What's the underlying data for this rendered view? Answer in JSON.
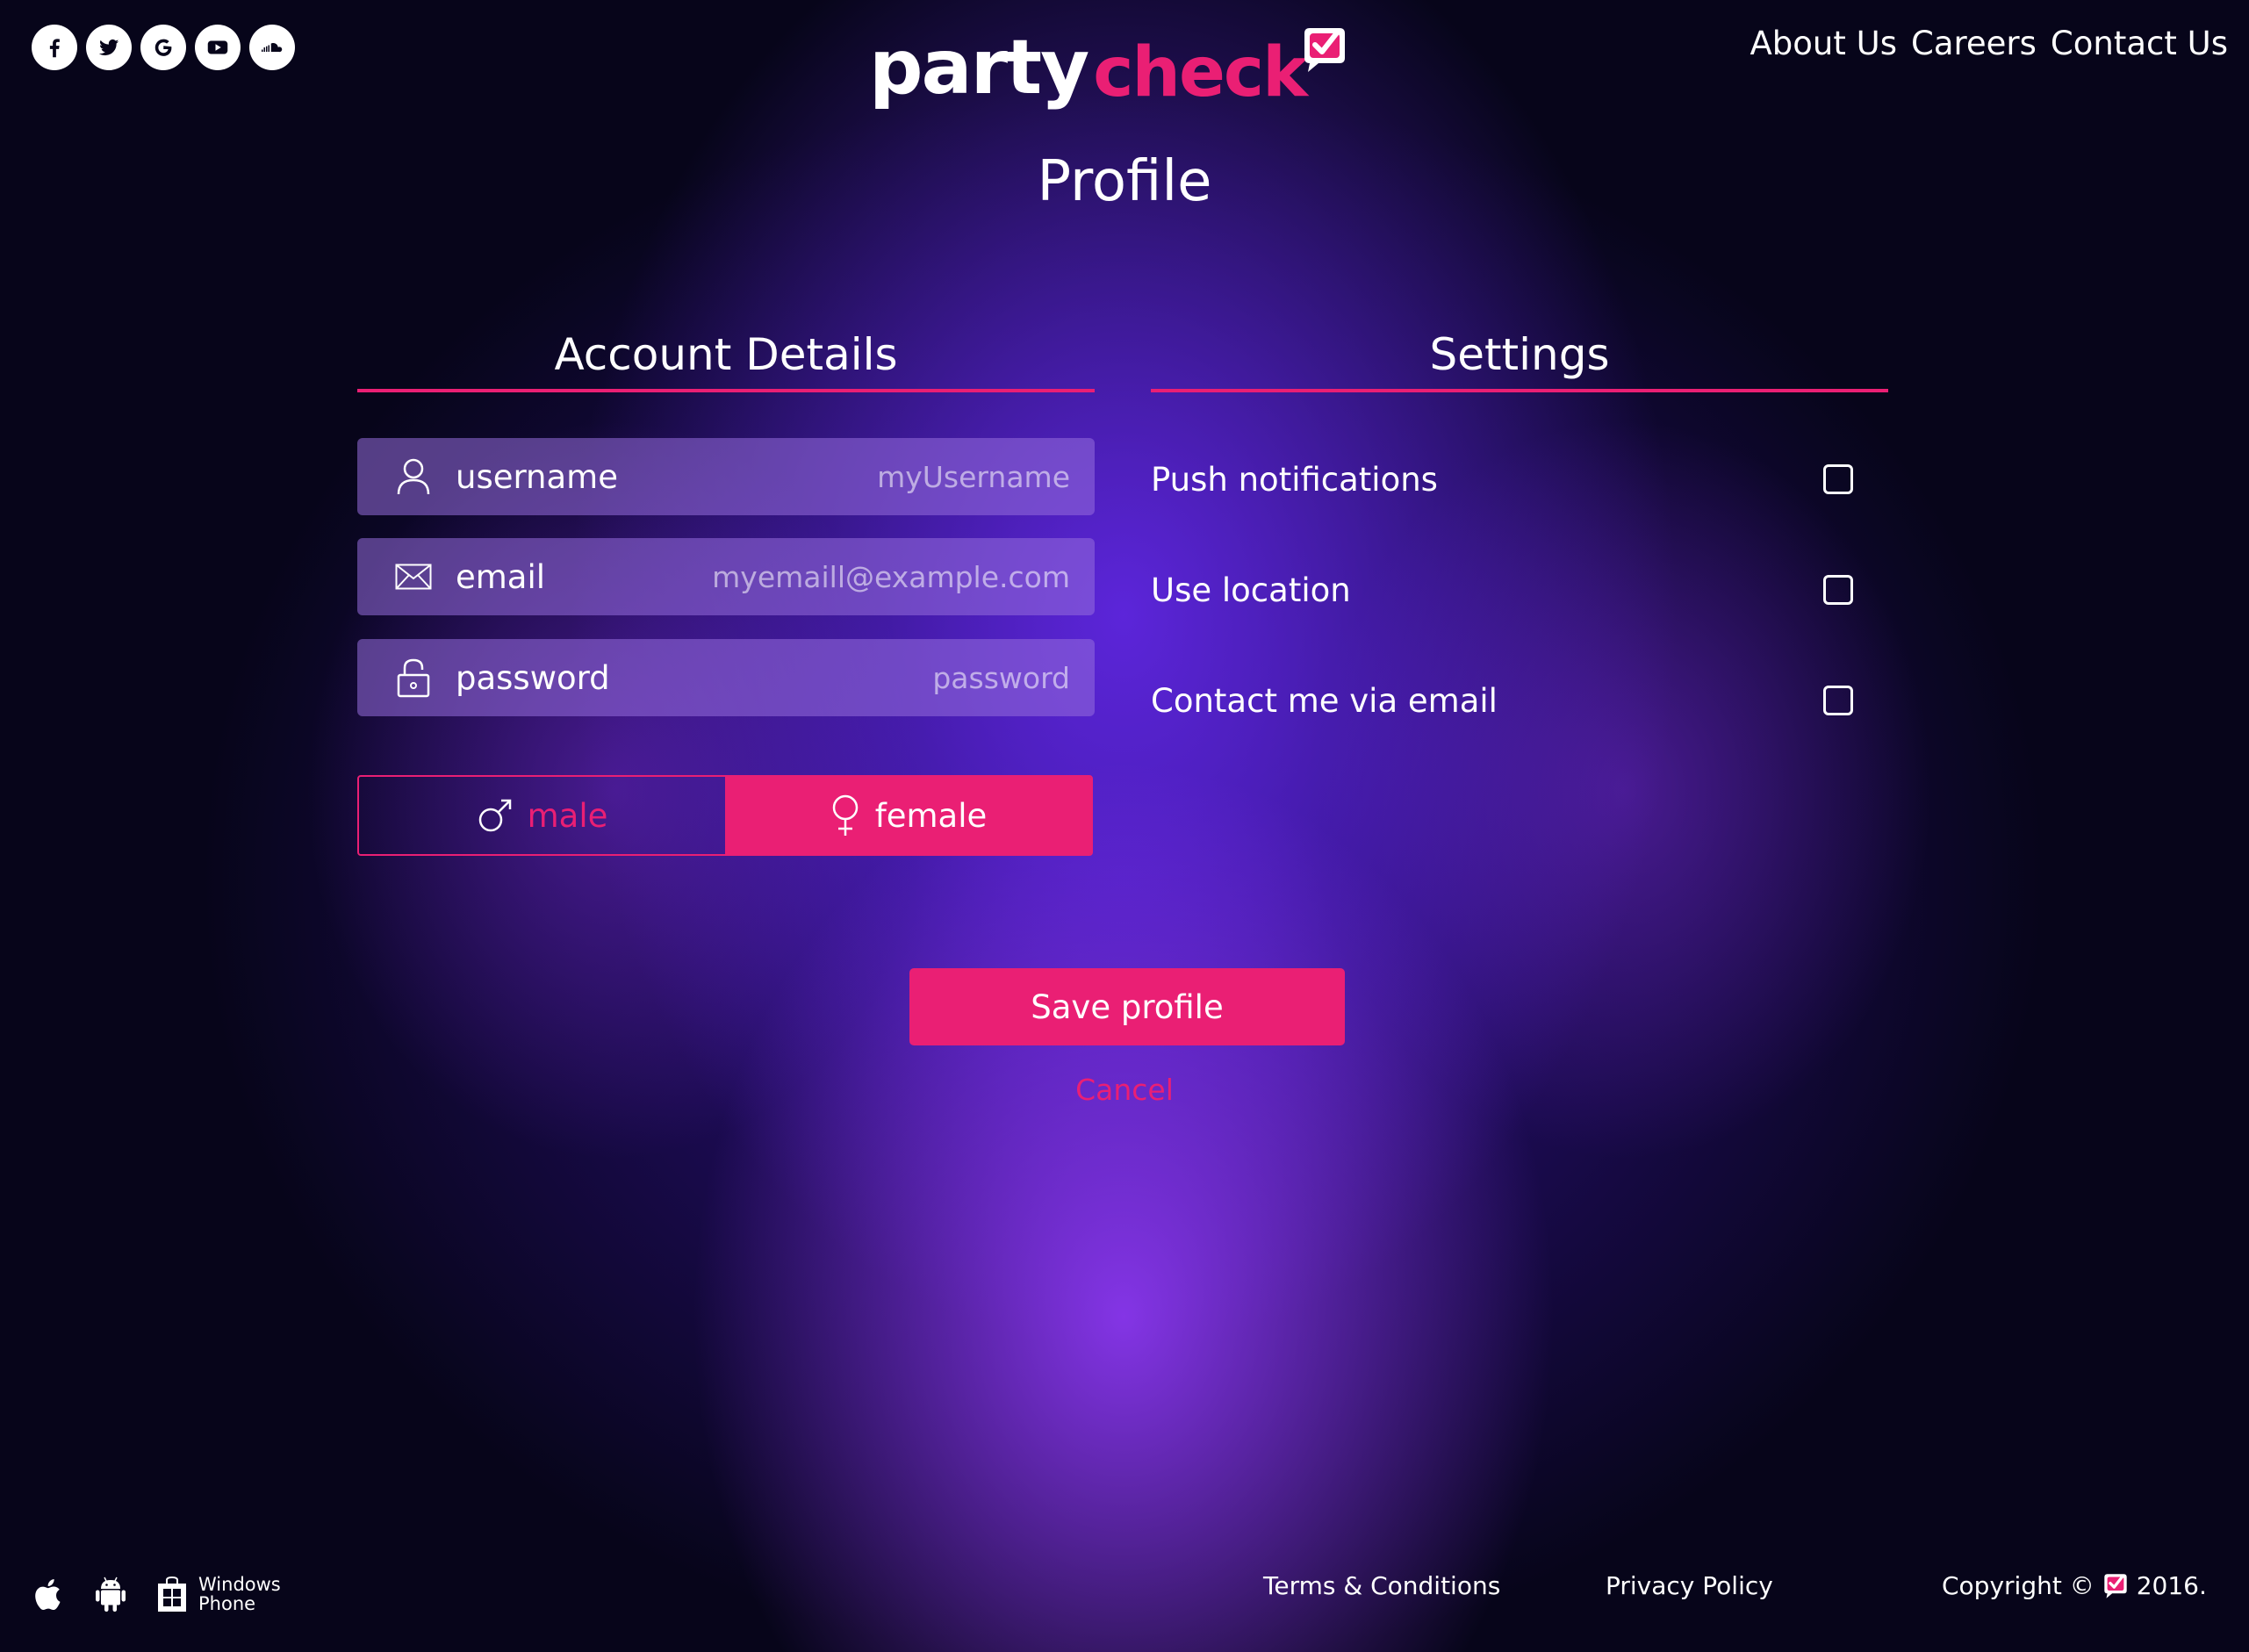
{
  "social": {
    "icons": [
      "facebook-icon",
      "twitter-icon",
      "google-icon",
      "youtube-icon",
      "soundcloud-icon"
    ]
  },
  "logo": {
    "part1": "party",
    "part2": "check"
  },
  "nav": {
    "about": "About Us",
    "careers": "Careers",
    "contact": "Contact Us"
  },
  "page": {
    "title": "Profile"
  },
  "account": {
    "title": "Account Details",
    "username_label": "username",
    "username_placeholder": "myUsername",
    "email_label": "email",
    "email_placeholder": "myemaill@example.com",
    "password_label": "password",
    "password_placeholder": "password",
    "gender": {
      "male": "male",
      "female": "female",
      "selected": "female"
    }
  },
  "settings": {
    "title": "Settings",
    "push": "Push notifications",
    "location": "Use location",
    "contact_email": "Contact me via email"
  },
  "actions": {
    "save": "Save profile",
    "cancel": "Cancel"
  },
  "footer": {
    "windows_line1": "Windows",
    "windows_line2": "Phone",
    "terms": "Terms & Conditions",
    "privacy": "Privacy Policy",
    "copyright_prefix": "Copyright ©",
    "copyright_year": "2016."
  },
  "colors": {
    "accent": "#ea1f74",
    "field_bg": "rgba(150,110,220,0.55)"
  }
}
